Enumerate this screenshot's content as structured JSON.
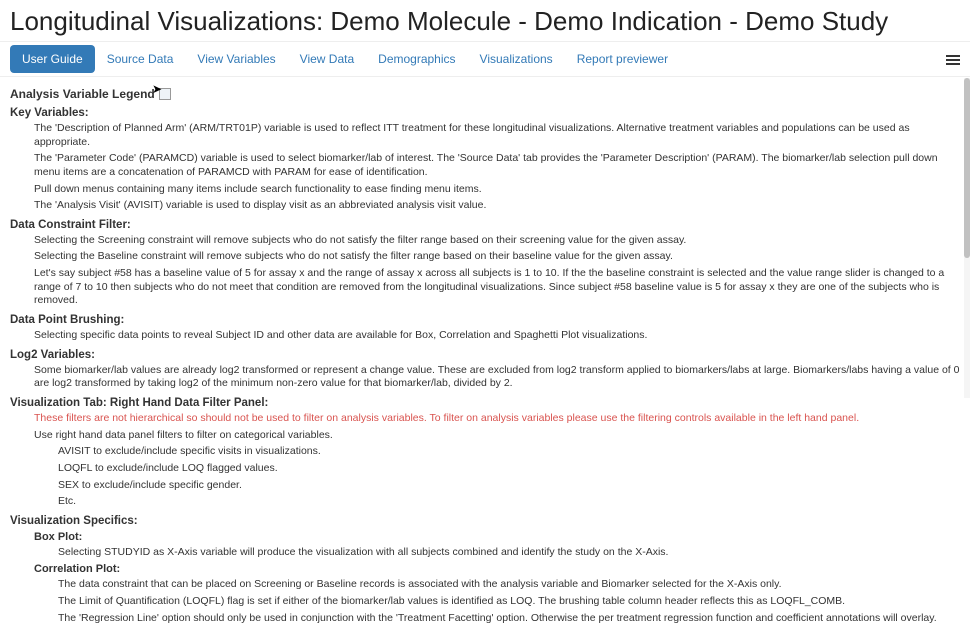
{
  "header": {
    "title": "Longitudinal Visualizations: Demo Molecule - Demo Indication - Demo Study"
  },
  "tabs": [
    {
      "label": "User Guide",
      "active": true
    },
    {
      "label": "Source Data",
      "active": false
    },
    {
      "label": "View Variables",
      "active": false
    },
    {
      "label": "View Data",
      "active": false
    },
    {
      "label": "Demographics",
      "active": false
    },
    {
      "label": "Visualizations",
      "active": false
    },
    {
      "label": "Report previewer",
      "active": false
    }
  ],
  "legend_title": "Analysis Variable Legend",
  "sections": {
    "key_vars": {
      "title": "Key Variables:",
      "p1": "The 'Description of Planned Arm' (ARM/TRT01P) variable is used to reflect ITT treatment for these longitudinal visualizations. Alternative treatment variables and populations can be used as appropriate.",
      "p2": "The 'Parameter Code' (PARAMCD) variable is used to select biomarker/lab of interest. The 'Source Data' tab provides the 'Parameter Description' (PARAM). The biomarker/lab selection pull down menu items are a concatenation of PARAMCD with PARAM for ease of identification.",
      "p3": "Pull down menus containing many items include search functionality to ease finding menu items.",
      "p4": "The 'Analysis Visit' (AVISIT) variable is used to display visit as an abbreviated analysis visit value."
    },
    "data_constraint": {
      "title": "Data Constraint Filter:",
      "p1": "Selecting the Screening constraint will remove subjects who do not satisfy the filter range based on their screening value for the given assay.",
      "p2": "Selecting the Baseline constraint will remove subjects who do not satisfy the filter range based on their baseline value for the given assay.",
      "p3": "Let's say subject #58 has a baseline value of 5 for assay x and the range of assay x across all subjects is 1 to 10. If the the baseline constraint is selected and the value range slider is changed to a range of 7 to 10 then subjects who do not meet that condition are removed from the longitudinal visualizations. Since subject #58 baseline value is 5 for assay x they are one of the subjects who is removed."
    },
    "brushing": {
      "title": "Data Point Brushing:",
      "p1": "Selecting specific data points to reveal Subject ID and other data are available for Box, Correlation and Spaghetti Plot visualizations."
    },
    "log2": {
      "title": "Log2 Variables:",
      "p1": "Some biomarker/lab values are already log2 transformed or represent a change value. These are excluded from log2 transform applied to biomarkers/labs at large. Biomarkers/labs having a value of 0 are log2 transformed by taking log2 of the minimum non-zero value for that biomarker/lab, divided by 2."
    },
    "viz_tab": {
      "title": "Visualization Tab: Right Hand Data Filter Panel:",
      "warn": "These filters are not hierarchical so should not be used to filter on analysis variables. To filter on analysis variables please use the filtering controls available in the left hand panel.",
      "p1": "Use right hand data panel filters to filter on categorical variables.",
      "b1": "AVISIT to exclude/include specific visits in visualizations.",
      "b2": "LOQFL to exclude/include LOQ flagged values.",
      "b3": "SEX to exclude/include specific gender.",
      "b4": "Etc."
    },
    "viz_specifics": {
      "title": "Visualization Specifics:",
      "box_title": "Box Plot:",
      "box_p1": "Selecting STUDYID as X-Axis variable will produce the visualization with all subjects combined and identify the study on the X-Axis.",
      "corr_title": "Correlation Plot:",
      "corr_p1": "The data constraint that can be placed on Screening or Baseline records is associated with the analysis variable and Biomarker selected for the X-Axis only.",
      "corr_p2": "The Limit of Quantification (LOQFL) flag is set if either of the biomarker/lab values is identified as LOQ. The brushing table column header reflects this as LOQFL_COMB.",
      "corr_p3": "The 'Regression Line' option should only be used in conjunction with the 'Treatment Facetting' option. Otherwise the per treatment regression function and coefficient annotations will overlay."
    }
  }
}
